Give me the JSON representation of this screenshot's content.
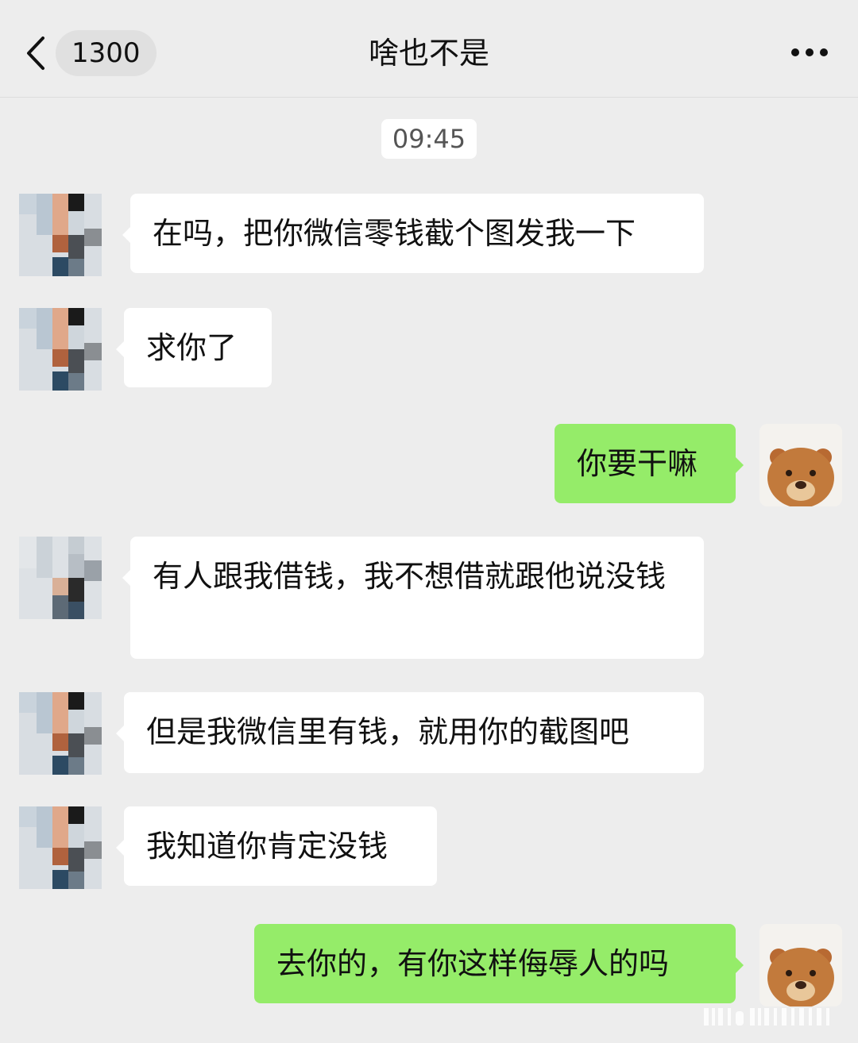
{
  "header": {
    "unread_count": "1300",
    "title": "啥也不是",
    "back_icon": "chevron-left-icon",
    "more_icon": "more-dots-icon"
  },
  "timestamp": "09:45",
  "messages": [
    {
      "side": "in",
      "text": "在吗，把你微信零钱截个图发我一下"
    },
    {
      "side": "in",
      "text": "求你了"
    },
    {
      "side": "out",
      "text": "你要干嘛"
    },
    {
      "side": "in",
      "text": "有人跟我借钱，我不想借就跟他说没钱"
    },
    {
      "side": "in",
      "text": "但是我微信里有钱，就用你的截图吧"
    },
    {
      "side": "in",
      "text": "我知道你肯定没钱"
    },
    {
      "side": "out",
      "text": "去你的，有你这样侮辱人的吗"
    }
  ],
  "colors": {
    "chat_background": "#ededed",
    "incoming_bubble": "#ffffff",
    "outgoing_bubble": "#95ec69"
  }
}
